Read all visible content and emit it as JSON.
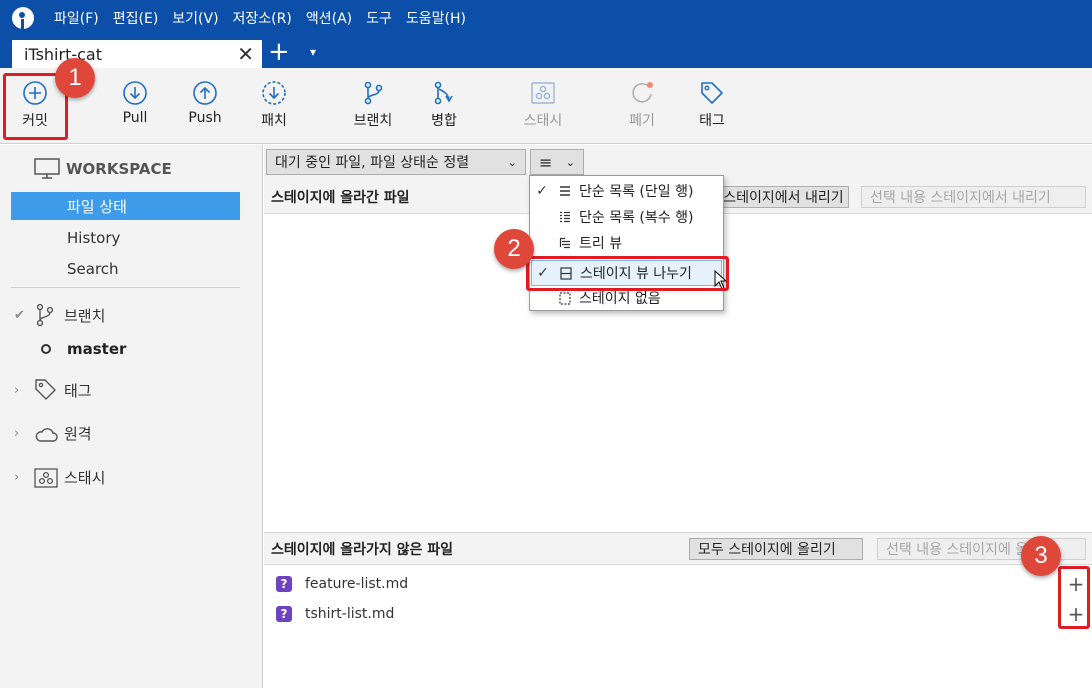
{
  "menubar": {
    "items": [
      "파일(F)",
      "편집(E)",
      "보기(V)",
      "저장소(R)",
      "액션(A)",
      "도구",
      "도움말(H)"
    ]
  },
  "tab": {
    "title": "iTshirt-cat",
    "close": "✕",
    "new": "+",
    "dropdown": "▾"
  },
  "toolbar": {
    "commit": "커밋",
    "pull": "Pull",
    "push": "Push",
    "patch": "패치",
    "branch": "브랜치",
    "merge": "병합",
    "stash": "스태시",
    "discard": "폐기",
    "tag": "태그"
  },
  "annotations": {
    "one": "1",
    "two": "2",
    "three": "3"
  },
  "sidebar": {
    "workspace": "WORKSPACE",
    "file_status": "파일 상태",
    "history": "History",
    "search": "Search",
    "branches": "브랜치",
    "master": "master",
    "tags": "태그",
    "remotes": "원격",
    "stashes": "스태시"
  },
  "filter": {
    "sort_label": "대기 중인 파일, 파일 상태순 정렬",
    "view_icon": "≡"
  },
  "staged": {
    "title": "스테이지에 올라간 파일",
    "unstage_all": "모두 스테이지에서 내리기",
    "unstage_selected": "선택 내용 스테이지에서 내리기"
  },
  "unstaged": {
    "title": "스테이지에 올라가지 않은 파일",
    "stage_all": "모두 스테이지에 올리기",
    "stage_selected": "선택 내용 스테이지에 올리기",
    "files": [
      "feature-list.md",
      "tshirt-list.md"
    ],
    "file_status_icon": "?",
    "stage_button": "+"
  },
  "view_menu": {
    "items": [
      "단순 목록 (단일 행)",
      "단순 목록 (복수 행)",
      "트리 뷰",
      "스테이지 뷰 나누기",
      "스테이지 없음"
    ],
    "check": "✓"
  }
}
